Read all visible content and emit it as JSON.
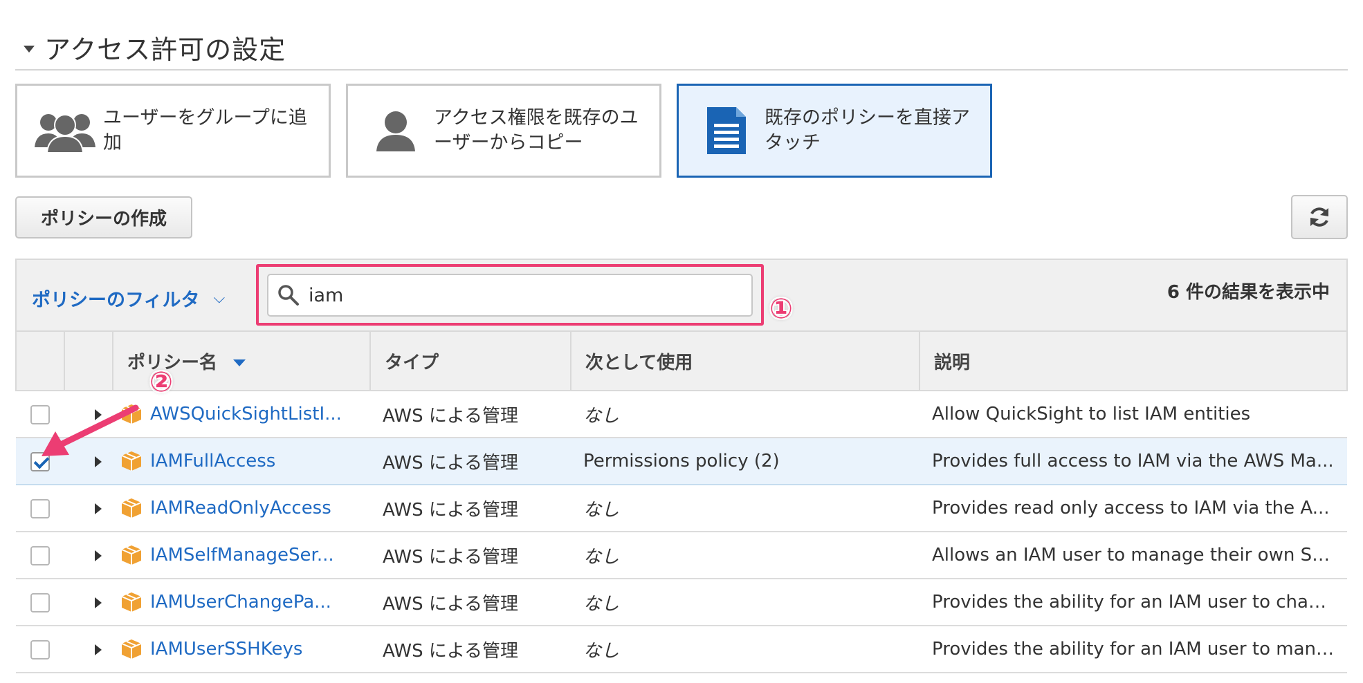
{
  "section": {
    "title": "アクセス許可の設定"
  },
  "options": [
    {
      "label": "ユーザーをグループに追加",
      "icon": "group-icon"
    },
    {
      "label": "アクセス権限を既存のユーザーからコピー",
      "icon": "user-icon"
    },
    {
      "label": "既存のポリシーを直接アタッチ",
      "icon": "document-icon",
      "selected": true
    }
  ],
  "toolbar": {
    "create_policy_label": "ポリシーの作成",
    "refresh_icon": "refresh-icon"
  },
  "filter": {
    "label": "ポリシーのフィルタ",
    "search_value": "iam",
    "result_count": "6 件の結果を表示中"
  },
  "annotations": {
    "one": "①",
    "two": "②"
  },
  "table": {
    "headers": {
      "name": "ポリシー名",
      "type": "タイプ",
      "used_as": "次として使用",
      "description": "説明"
    },
    "rows": [
      {
        "name": "AWSQuickSightListI...",
        "type": "AWS による管理",
        "used_as": "なし",
        "description": "Allow QuickSight to list IAM entities",
        "checked": false
      },
      {
        "name": "IAMFullAccess",
        "type": "AWS による管理",
        "used_as": "Permissions policy (2)",
        "description": "Provides full access to IAM via the AWS Ma...",
        "checked": true
      },
      {
        "name": "IAMReadOnlyAccess",
        "type": "AWS による管理",
        "used_as": "なし",
        "description": "Provides read only access to IAM via the A...",
        "checked": false
      },
      {
        "name": "IAMSelfManageSer...",
        "type": "AWS による管理",
        "used_as": "なし",
        "description": "Allows an IAM user to manage their own Se...",
        "checked": false
      },
      {
        "name": "IAMUserChangePa...",
        "type": "AWS による管理",
        "used_as": "なし",
        "description": "Provides the ability for an IAM user to chan...",
        "checked": false
      },
      {
        "name": "IAMUserSSHKeys",
        "type": "AWS による管理",
        "used_as": "なし",
        "description": "Provides the ability for an IAM user to mana...",
        "checked": false
      }
    ]
  },
  "colors": {
    "accent": "#1f6ac3",
    "selected_border": "#1a64b4",
    "highlight": "#ec3d73",
    "policy_icon": "#f0a133"
  }
}
